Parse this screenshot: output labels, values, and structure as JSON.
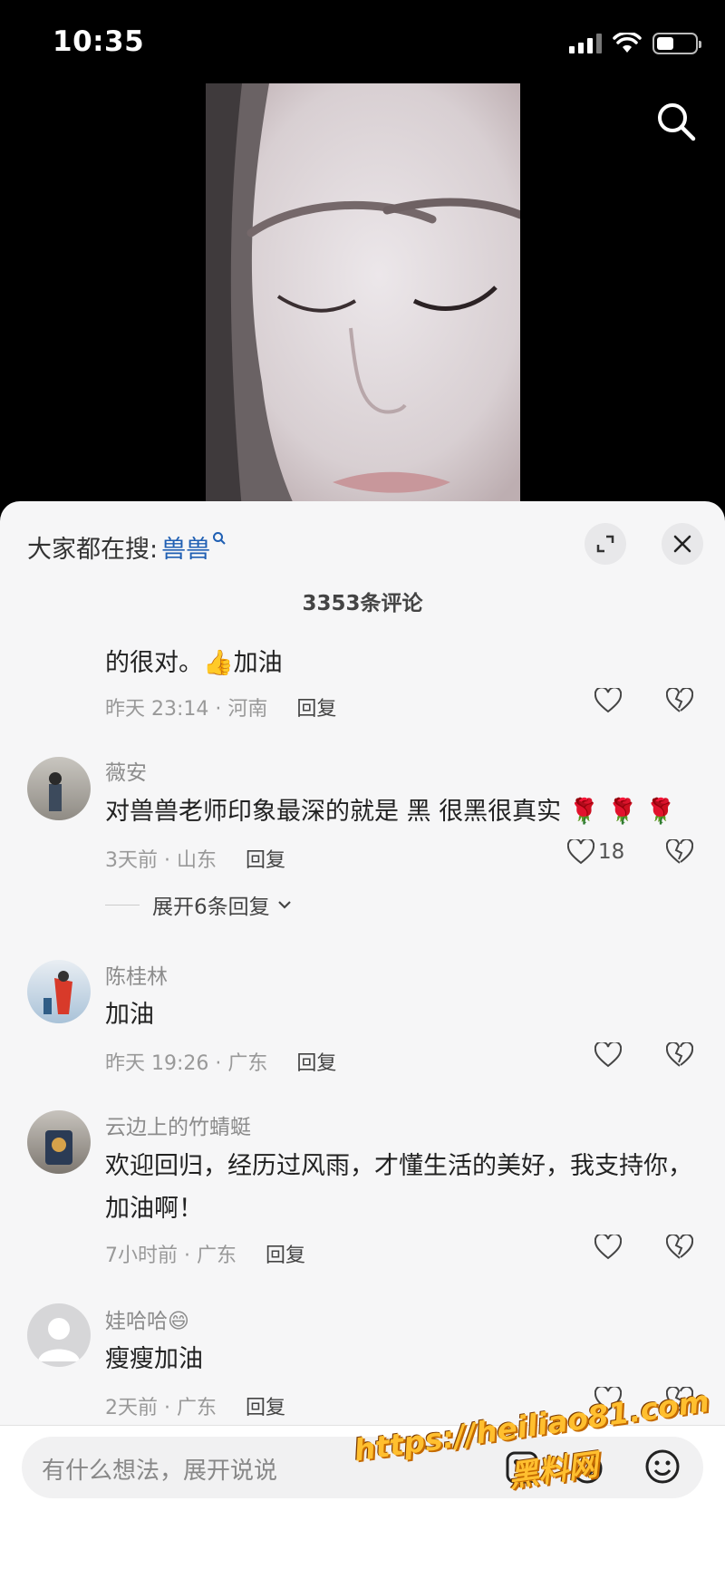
{
  "status_bar": {
    "time": "10:35"
  },
  "comments_panel": {
    "hot_search_label": "大家都在搜:",
    "hot_search_keyword": "兽兽",
    "comment_count": "3353条评论",
    "comments": [
      {
        "text": "的很对。👍加油",
        "time_location": "昨天 23:14 · 河南",
        "reply_label": "回复"
      },
      {
        "user": "薇安",
        "text": "对兽兽老师印象最深的就是 黑 很黑很真实 🌹 🌹 🌹",
        "time_location": "3天前 · 山东",
        "reply_label": "回复",
        "likes": "18"
      },
      {
        "user": "陈桂林",
        "text": "加油",
        "time_location": "昨天 19:26 · 广东",
        "reply_label": "回复"
      },
      {
        "user": "云边上的竹蜻蜓",
        "text": "欢迎回归，经历过风雨，才懂生活的美好，我支持你，加油啊！",
        "time_location": "7小时前 · 广东",
        "reply_label": "回复"
      },
      {
        "user": "娃哈哈😄",
        "text": "瘦瘦加油",
        "time_location": "2天前 · 广东",
        "reply_label": "回复"
      }
    ],
    "expand_replies": "展开6条回复"
  },
  "input_bar": {
    "placeholder": "有什么想法，展开说说"
  },
  "watermark": {
    "url": "https://heiliao81.com",
    "name": "黑料网"
  },
  "colors": {
    "keyword_blue": "#1f5fb3",
    "sheet_bg": "#f6f6f7",
    "watermark": "#ffbf2f"
  }
}
